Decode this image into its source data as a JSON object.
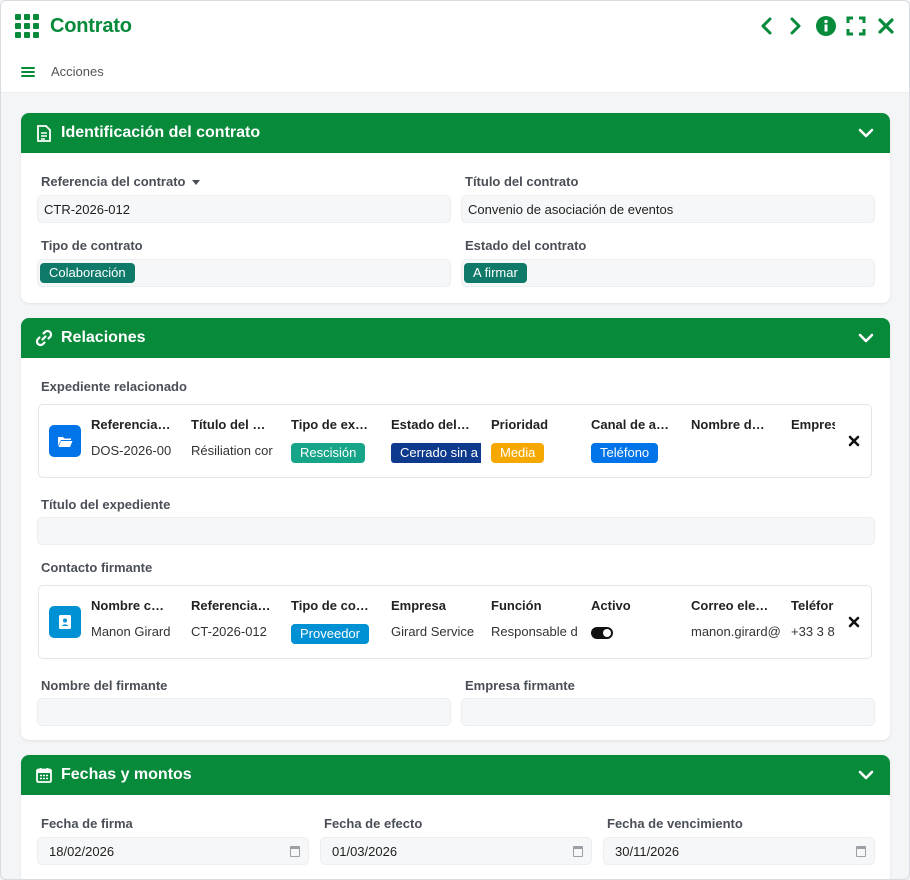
{
  "window": {
    "title": "Contrato",
    "toolbar_label": "Acciones",
    "icons": [
      "grid-icon",
      "chevron-left-icon",
      "chevron-right-icon",
      "info-icon",
      "fullscreen-icon",
      "close-icon"
    ]
  },
  "colors": {
    "brand": "#078a3a",
    "teal": "#0f7a6a",
    "blue": "#0074e8",
    "navy": "#0d3a8c",
    "amber": "#f5a800",
    "sky": "#0091d4"
  },
  "sections": {
    "identificacion": {
      "title": "Identificación del contrato",
      "ref_label": "Referencia del contrato",
      "ref_value": "CTR-2026-012",
      "titulo_label": "Título del contrato",
      "titulo_value": "Convenio de asociación de eventos",
      "tipo_label": "Tipo de contrato",
      "tipo_value": "Colaboración",
      "estado_label": "Estado del contrato",
      "estado_value": "A firmar"
    },
    "relaciones": {
      "title": "Relaciones",
      "expediente_label": "Expediente relacionado",
      "expediente": {
        "headers": [
          "Referencia…",
          "Título del …",
          "Tipo de ex…",
          "Estado del…",
          "Prioridad",
          "Canal de a…",
          "Nombre d…",
          "Empres"
        ],
        "values": [
          "DOS-2026-00",
          "Résiliation cor",
          "Rescisión",
          "Cerrado sin a",
          "Media",
          "Teléfono",
          "",
          ""
        ]
      },
      "titulo_expediente_label": "Título del expediente",
      "contacto_label": "Contacto firmante",
      "contacto": {
        "headers": [
          "Nombre c…",
          "Referencia…",
          "Tipo de co…",
          "Empresa",
          "Función",
          "Activo",
          "Correo ele…",
          "Teléfor"
        ],
        "values": [
          "Manon Girard",
          "CT-2026-012",
          "Proveedor",
          "Girard Service",
          "Responsable d",
          "",
          "manon.girard@",
          "+33 3 8"
        ]
      },
      "nombre_firmante_label": "Nombre del firmante",
      "empresa_firmante_label": "Empresa firmante"
    },
    "fechas": {
      "title": "Fechas y montos",
      "firma_label": "Fecha de firma",
      "firma_value": "18/02/2026",
      "efecto_label": "Fecha de efecto",
      "efecto_value": "01/03/2026",
      "vencimiento_label": "Fecha de vencimiento",
      "vencimiento_value": "30/11/2026"
    }
  }
}
